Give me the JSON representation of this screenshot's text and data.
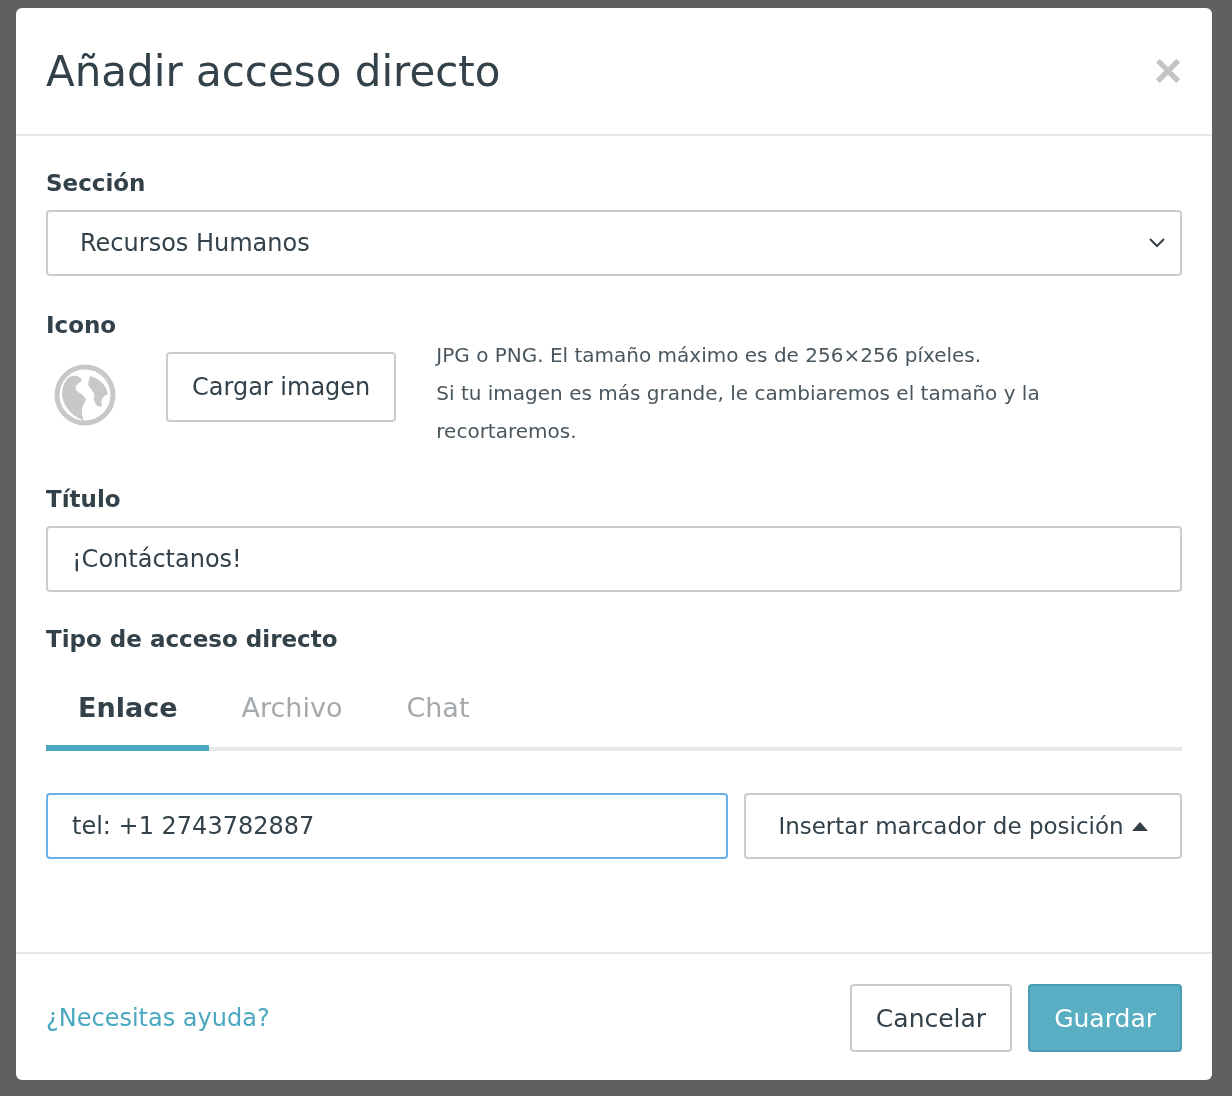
{
  "dialog": {
    "title": "Añadir acceso directo",
    "close": "×"
  },
  "section": {
    "label": "Sección",
    "value": "Recursos Humanos"
  },
  "icon": {
    "label": "Icono",
    "upload_button": "Cargar imagen",
    "hints": [
      "JPG o PNG. El tamaño máximo es de 256×256 píxeles.",
      "Si tu imagen es más grande, le cambiaremos el tamaño y la recortaremos."
    ]
  },
  "title_field": {
    "label": "Título",
    "value": "¡Contáctanos!"
  },
  "shortcut_type": {
    "label": "Tipo de acceso directo",
    "tabs": [
      {
        "label": "Enlace",
        "selected": true
      },
      {
        "label": "Archivo",
        "selected": false
      },
      {
        "label": "Chat",
        "selected": false
      }
    ]
  },
  "link": {
    "value": "tel: +1 2743782887",
    "focused": true,
    "placeholder_button": "Insertar marcador de posición"
  },
  "footer": {
    "help_link": "¿Necesitas ayuda?",
    "buttons": [
      {
        "label": "Cancelar",
        "kind": "secondary"
      },
      {
        "label": "Guardar",
        "kind": "primary"
      }
    ]
  }
}
